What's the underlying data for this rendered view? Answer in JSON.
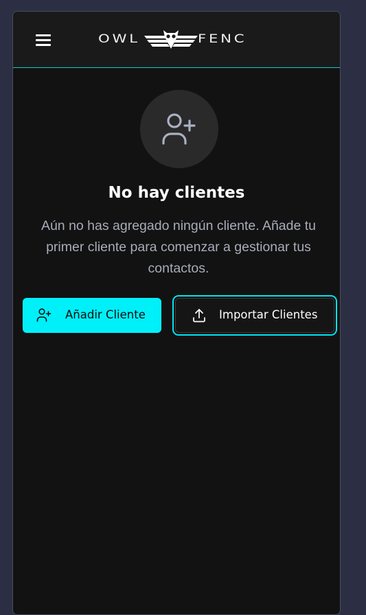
{
  "header": {
    "logo_left": "OWL",
    "logo_right": "FENC"
  },
  "empty_state": {
    "title": "No hay clientes",
    "description": "Aún no has agregado ningún cliente. Añade tu primer cliente para comenzar a gestionar tus contactos."
  },
  "actions": {
    "add_label": "Añadir Cliente",
    "import_label": "Importar Clientes"
  },
  "icons": {
    "menu": "menu-icon",
    "empty": "user-plus-icon",
    "add": "user-plus-icon",
    "import": "upload-icon"
  },
  "colors": {
    "accent": "#00f0fa",
    "background": "#121212",
    "header_border": "#19c9d1",
    "muted_text": "#a9acb9"
  }
}
